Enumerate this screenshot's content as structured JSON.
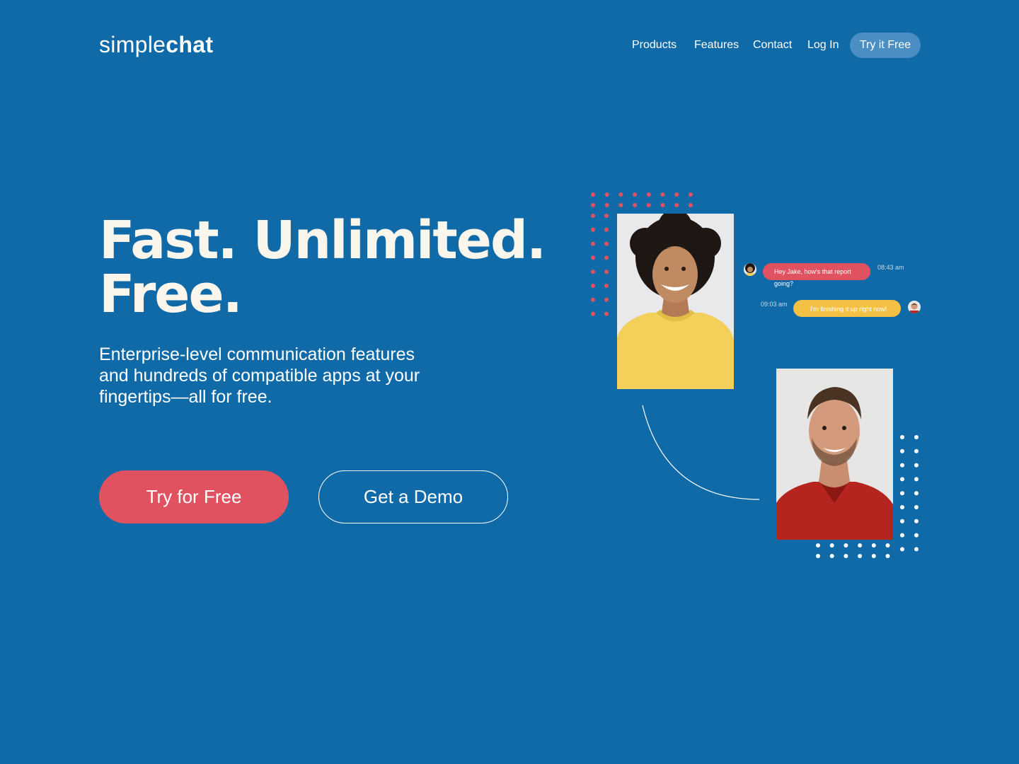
{
  "brand": {
    "light": "simple",
    "bold": "chat"
  },
  "nav": {
    "links": [
      "Products",
      "Features",
      "Contact",
      "Log In"
    ],
    "cta": "Try it Free"
  },
  "hero": {
    "headline_line1": "Fast. Unlimited.",
    "headline_line2": "Free.",
    "subtext": "Enterprise-level communication features and hundreds of compatible apps at your fingertips—all for free.",
    "primary_button": "Try for Free",
    "secondary_button": "Get a Demo"
  },
  "chat": {
    "message1": {
      "text": "Hey Jake, how's that report",
      "overflow": "going?",
      "time": "08:43 am"
    },
    "message2": {
      "text": "I'm finishing it up right now!",
      "time": "09:03 am"
    }
  },
  "colors": {
    "background": "#106AA8",
    "accent_red": "#E05260",
    "accent_yellow": "#F5C144",
    "headline_cream": "#FBF6EC",
    "nav_cta_bg": "#4A8EC4"
  },
  "icons": [
    "woman-avatar-icon",
    "man-avatar-icon",
    "connector-curve"
  ]
}
